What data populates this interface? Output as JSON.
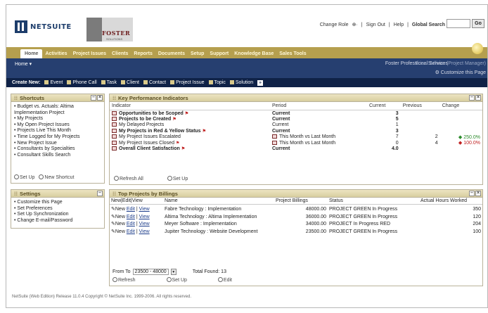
{
  "header": {
    "logo_text": "NETSUITE",
    "brand": "FOSTER",
    "brand_sub": "SOLUTIONS",
    "change_role": "Change Role",
    "sign_out": "Sign Out",
    "help": "Help",
    "global_search": "Global Search",
    "search_value": "",
    "go_label": "Go"
  },
  "tabs": [
    "Home",
    "Activities",
    "Project Issues",
    "Clients",
    "Reports",
    "Documents",
    "Setup",
    "Support",
    "Knowledge Base",
    "Sales Tools"
  ],
  "active_tab": "Home",
  "subbar": {
    "home_label": "Home ▾",
    "company": "Foster Professional Services",
    "user_role": "Brian Sullivan (Project Manager)",
    "customize": "Customize this Page"
  },
  "create_new": {
    "label": "Create New:",
    "items": [
      "Event",
      "Phone Call",
      "Task",
      "Client",
      "Contact",
      "Project Issue",
      "Topic",
      "Solution"
    ]
  },
  "shortcuts": {
    "title": "Shortcuts",
    "items": [
      "Budget vs. Actuals: Altima Implementation Project",
      "My Projects",
      "My Open Project Issues",
      "Projects Live This Month",
      "Time Logged for My Projects",
      "New Project Issue",
      "Consultants by Specialties",
      "Consultant Skills Search"
    ],
    "setup": "Set Up",
    "new_shortcut": "New Shortcut"
  },
  "settings": {
    "title": "Settings",
    "items": [
      "Customize this Page",
      "Set Preferences",
      "Set Up Synchronization",
      "Change E-mail/Password"
    ]
  },
  "kpi": {
    "title": "Key Performance Indicators",
    "headers": [
      "Indicator",
      "Period",
      "Current",
      "Previous",
      "Change"
    ],
    "rows": [
      {
        "indicator": "Opportunities to be Scoped",
        "bold": true,
        "flag": true,
        "period": "Current",
        "current": "3",
        "previous": "",
        "change": "",
        "dir": ""
      },
      {
        "indicator": "Projects to be Created",
        "bold": true,
        "flag": true,
        "period": "Current",
        "current": "5",
        "previous": "",
        "change": "",
        "dir": ""
      },
      {
        "indicator": "My Delayed Projects",
        "bold": false,
        "flag": false,
        "period": "Current",
        "current": "1",
        "previous": "",
        "change": "",
        "dir": ""
      },
      {
        "indicator": "My Projects in Red & Yellow Status",
        "bold": true,
        "flag": true,
        "period": "Current",
        "current": "3",
        "previous": "",
        "change": "",
        "dir": ""
      },
      {
        "indicator": "My Project Issues Escalated",
        "bold": false,
        "flag": false,
        "period": "This Month vs Last Month",
        "current": "7",
        "previous": "2",
        "change": "250.0%",
        "dir": "up"
      },
      {
        "indicator": "My Project Issues Closed",
        "bold": false,
        "flag": true,
        "period": "This Month vs Last Month",
        "current": "0",
        "previous": "4",
        "change": "100.0%",
        "dir": "down"
      },
      {
        "indicator": "Overall Client Satisfaction",
        "bold": true,
        "flag": true,
        "period": "Current",
        "current": "4.0",
        "previous": "",
        "change": "",
        "dir": ""
      }
    ],
    "refresh": "Refresh All",
    "setup": "Set Up"
  },
  "top_projects": {
    "title": "Top Projects by Billings",
    "headers": [
      "New",
      "Edit",
      "View",
      "Name",
      "Project Billings",
      "Status",
      "Actual Hours Worked"
    ],
    "rows": [
      {
        "name": "Fabre Technology : Implementation",
        "billings": "48000.00",
        "status_code": "PROJECT GREEN",
        "status": "In Progress",
        "flag": "",
        "hours": "350"
      },
      {
        "name": "Altima Technology : Altima Implementation",
        "billings": "36000.00",
        "status_code": "PROJECT GREEN",
        "status": "In Progress",
        "flag": "",
        "hours": "120"
      },
      {
        "name": "Meyer Software : Implementation",
        "billings": "34000.00",
        "status_code": "PROJECT",
        "status": "In Progress",
        "flag": "RED",
        "hours": "204"
      },
      {
        "name": "Jupiter Technology : Website Development",
        "billings": "23500.00",
        "status_code": "PROJECT GREEN",
        "status": "In Progress",
        "flag": "",
        "hours": "100"
      }
    ],
    "new_label": "New",
    "edit_label": "Edit",
    "view_label": "View",
    "range_label": "From To",
    "range_value": "23500 - 48000",
    "total_found": "Total Found: 13",
    "refresh": "Refresh",
    "setup": "Set Up",
    "edit": "Edit"
  },
  "footer": "NetSuite (Web Edition) Release 11.0.4 Copyright © NetSuite Inc. 1999-2006. All rights reserved."
}
